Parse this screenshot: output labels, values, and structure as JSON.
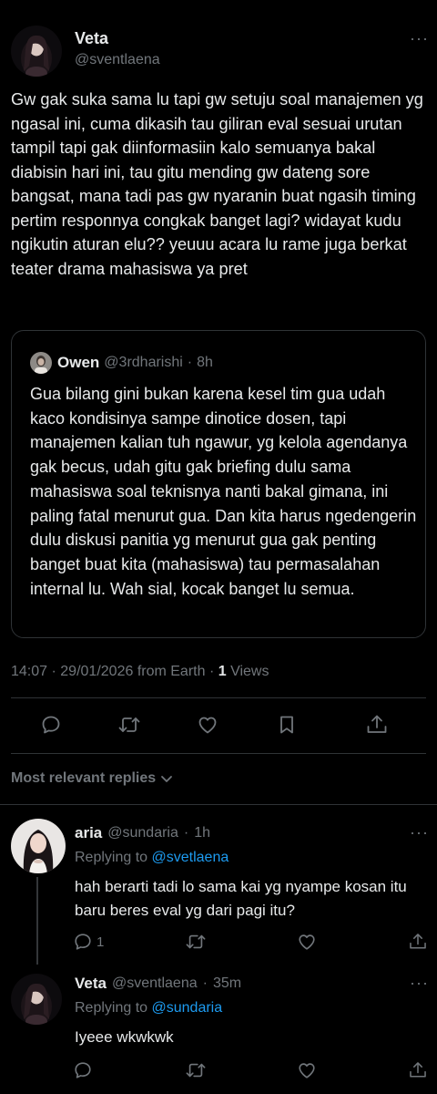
{
  "tweet": {
    "name": "Veta",
    "handle": "@sventlaena",
    "text": "Gw gak suka sama lu tapi gw setuju soal manajemen yg ngasal ini, cuma dikasih tau giliran eval sesuai urutan tampil tapi gak diinformasiin kalo semuanya bakal diabisin hari ini, tau gitu mending gw dateng sore bangsat, mana tadi pas gw nyaranin buat ngasih timing pertim responnya congkak banget lagi? widayat kudu ngikutin aturan elu?? yeuuu acara lu rame juga berkat teater drama mahasiswa ya pret",
    "more_label": "···",
    "quote": {
      "name": "Owen",
      "handle": "@3rdharishi",
      "dot": "·",
      "time": "8h",
      "text": "Gua bilang gini bukan karena kesel tim gua udah kaco kondisinya sampe dinotice dosen, tapi manajemen kalian tuh ngawur, yg kelola agendanya gak becus, udah gitu gak briefing dulu sama mahasiswa soal teknisnya nanti bakal gimana, ini paling fatal menurut gua. Dan kita harus ngedengerin dulu diskusi panitia yg menurut gua gak penting banget buat kita (mahasiswa) tau permasalahan internal lu. Wah sial, kocak banget lu semua."
    },
    "meta": {
      "time": "14:07",
      "sep1": "·",
      "date": "29/01/2026",
      "source": "from Earth",
      "sep2": "·",
      "views_count": "1",
      "views_label": "Views"
    }
  },
  "replies_header": {
    "label": "Most relevant replies"
  },
  "replies": [
    {
      "name": "aria",
      "handle": "@sundaria",
      "dot": "·",
      "time": "1h",
      "replying_prefix": "Replying to",
      "replying_to": "@svetlaena",
      "text": "hah berarti tadi lo sama kai yg nyampe kosan itu baru beres eval yg dari pagi itu?",
      "reply_count": "1",
      "more_label": "···"
    },
    {
      "name": "Veta",
      "handle": "@sventlaena",
      "dot": "·",
      "time": "35m",
      "replying_prefix": "Replying to",
      "replying_to": "@sundaria",
      "text": "Iyeee wkwkwk",
      "reply_count": "",
      "more_label": "···"
    }
  ],
  "icons": {
    "reply": "reply-icon",
    "retweet": "retweet-icon",
    "like": "heart-icon",
    "bookmark": "bookmark-icon",
    "share": "share-icon",
    "chevron": "chevron-down-icon"
  },
  "colors": {
    "background": "#000000",
    "text": "#e7e9ea",
    "secondary": "#71767b",
    "link": "#1d9bf0",
    "border": "#2f3336"
  }
}
